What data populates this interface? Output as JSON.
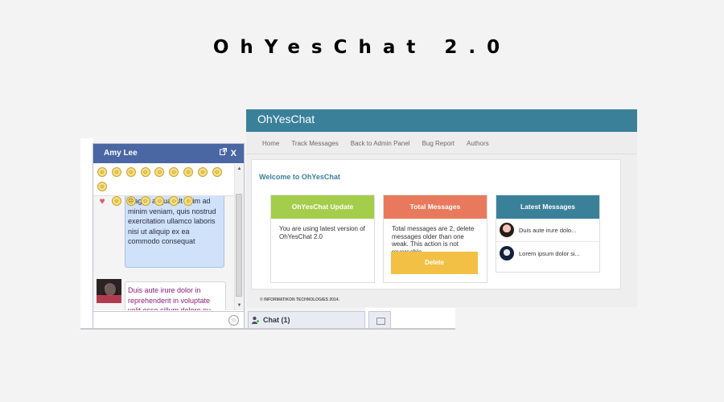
{
  "hero": {
    "title": "OhYesChat 2.0"
  },
  "admin": {
    "app_name": "OhYesChat",
    "nav": [
      "Home",
      "Track Messages",
      "Back to Admin Panel",
      "Bug Report",
      "Authors"
    ],
    "welcome": "Welcome to OhYesChat",
    "cards": {
      "update": {
        "title": "OhYesChat Update",
        "text": "You are using latest version of OhYesChat 2.0",
        "color": "#a4cd4b"
      },
      "total": {
        "title": "Total Messages",
        "text": "Total messages are 2, delete messages older than one weak. This action is not reversable.",
        "button": "Delete",
        "color": "#e8795c",
        "button_color": "#f3c046"
      },
      "latest": {
        "title": "Latest Messages",
        "color": "#3a8099",
        "items": [
          "Duis aute irure dolo...",
          "Lorem ipsum dolor si..."
        ]
      }
    },
    "footer": "© INFORMATIKON TECHNOLOGIES 2014."
  },
  "chat": {
    "name": "Amy Lee",
    "close": "X",
    "emojis": [
      "smile",
      "smile",
      "grin",
      "neutral",
      "tongue",
      "cool",
      "neutral",
      "surprised",
      "neutral",
      "angel",
      "heart",
      "devil",
      "sad",
      "confused",
      "neutral",
      "cool",
      "neutral"
    ],
    "messages": {
      "out": "magna aliqua. Ut enim ad minim veniam, quis nostrud exercitation ullamco laboris nisi ut aliquip ex ea commodo consequat",
      "in": "Duis aute irure dolor in reprehenderit in voluptate velit esse cillum dolore eu fugiat nulla pariatur"
    }
  },
  "taskbar": {
    "chat_tab": "Chat (1)"
  }
}
